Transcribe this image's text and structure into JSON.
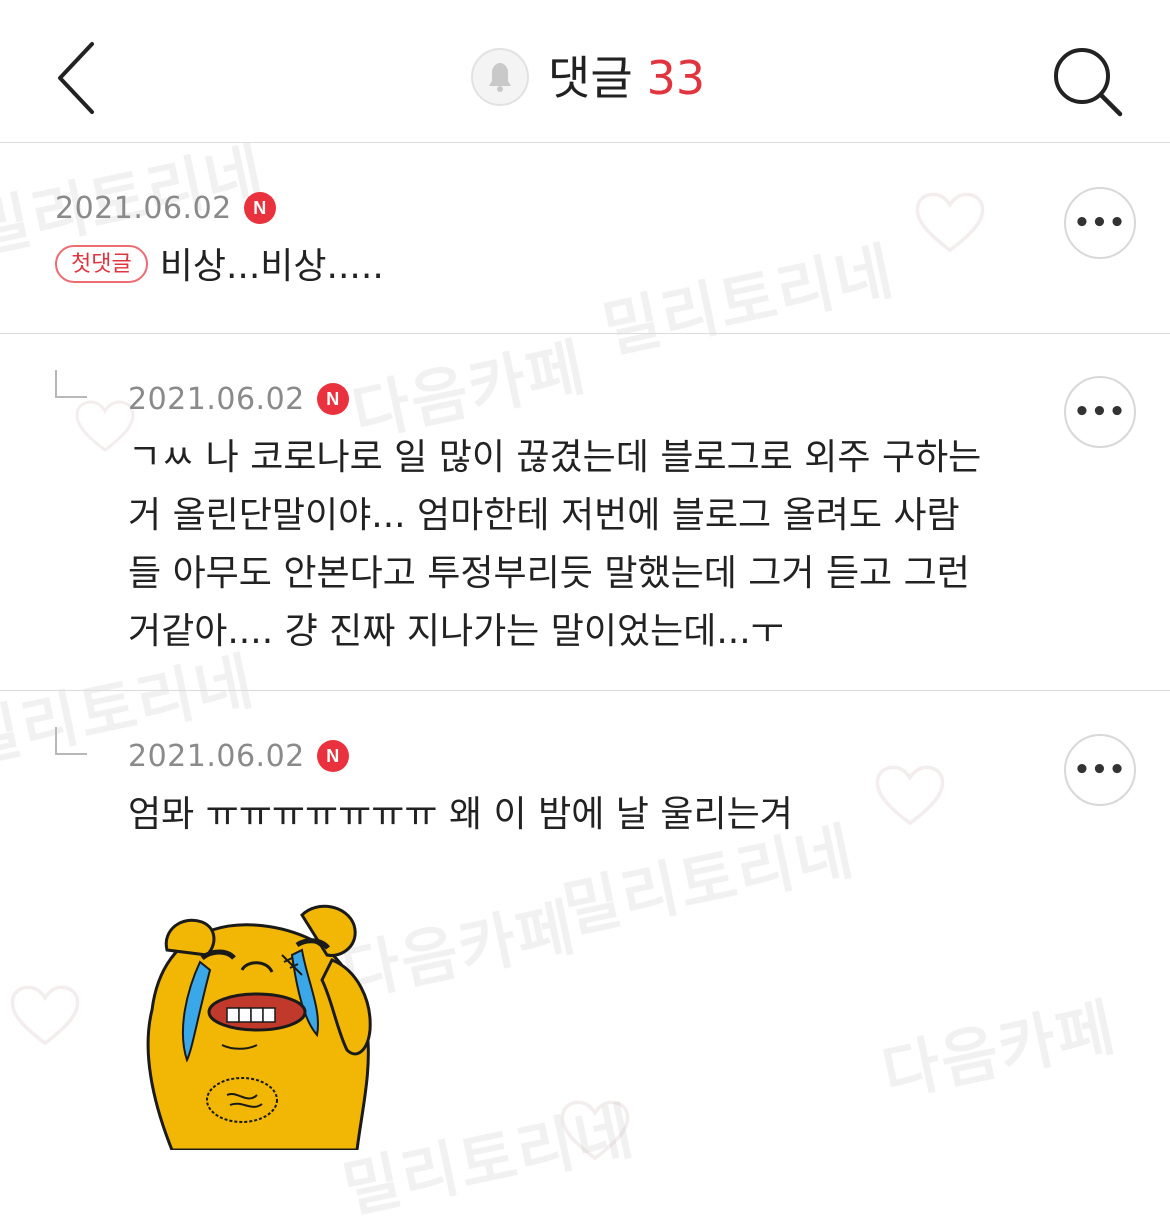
{
  "header": {
    "back_icon": "chevron-left-icon",
    "bell_icon": "bell-icon",
    "title": "댓글",
    "count": "33",
    "search_icon": "search-icon"
  },
  "watermark": {
    "cafe": "다음카페",
    "brand": "밀리토리네"
  },
  "comments": [
    {
      "date": "2021.06.02",
      "badge": "N",
      "first_label": "첫댓글",
      "text": "비상...비상.....",
      "more": "•••",
      "is_reply": false
    },
    {
      "date": "2021.06.02",
      "badge": "N",
      "lines": [
        "ㄱㅆ 나 코로나로 일 많이 끊겼는데 블로그로 외주 구하는",
        "거 올린단말이야... 엄마한테 저번에 블로그 올려도 사람",
        "들 아무도 안본다고 투정부리듯 말했는데 그거 듣고 그런",
        "거같아.... 걍 진짜 지나가는 말이었는데...ㅜ"
      ],
      "more": "•••",
      "is_reply": true
    },
    {
      "date": "2021.06.02",
      "badge": "N",
      "text": "엄뫄 ㅠㅠㅠㅠㅠㅠㅠ 왜 이 밤에 날 울리는겨",
      "more": "•••",
      "is_reply": true,
      "sticker": "crying-bear-sticker"
    }
  ],
  "colors": {
    "accent_red": "#e0343f",
    "badge_red": "#e9323d",
    "date_gray": "#8a8a8a",
    "divider": "#dcdcdc",
    "sticker_yellow": "#f2b705"
  }
}
